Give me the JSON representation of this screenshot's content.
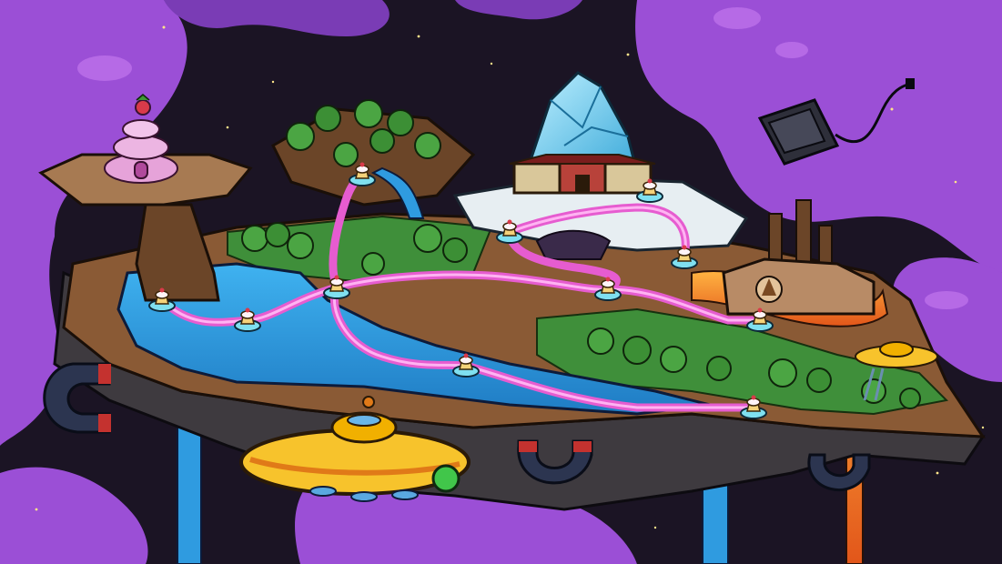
{
  "scene": {
    "kind": "level-select world map",
    "colors": {
      "space": "#1b1424",
      "cloud": "#9b4fd6",
      "cloud_light": "#b66ae6",
      "water": "#2f9be0",
      "ground": "#8a5a35",
      "grass": "#3f8f3a",
      "path": "#e65cd0",
      "path_glow": "#ffb3f2",
      "lava": "#f07a1a",
      "crystal": "#7fd6f7",
      "ufo": "#f7c32c"
    },
    "level_nodes": [
      {
        "id": "level-1",
        "icon": "cupcake-icon"
      },
      {
        "id": "level-2",
        "icon": "cupcake-icon"
      },
      {
        "id": "level-3",
        "icon": "cupcake-icon"
      },
      {
        "id": "level-4",
        "icon": "cupcake-icon"
      },
      {
        "id": "level-5",
        "icon": "cupcake-icon"
      },
      {
        "id": "level-6",
        "icon": "cupcake-icon"
      },
      {
        "id": "level-7",
        "icon": "cupcake-icon"
      },
      {
        "id": "level-8",
        "icon": "cupcake-icon"
      },
      {
        "id": "level-9",
        "icon": "cupcake-icon"
      },
      {
        "id": "level-10",
        "icon": "cupcake-icon"
      },
      {
        "id": "level-11",
        "icon": "cupcake-icon"
      }
    ],
    "landmarks": [
      "cake-house",
      "crystal-mountain",
      "castle",
      "chocolate-factory",
      "ufo-ship",
      "flying-tv",
      "magnet",
      "waterfall",
      "lava-river"
    ]
  }
}
